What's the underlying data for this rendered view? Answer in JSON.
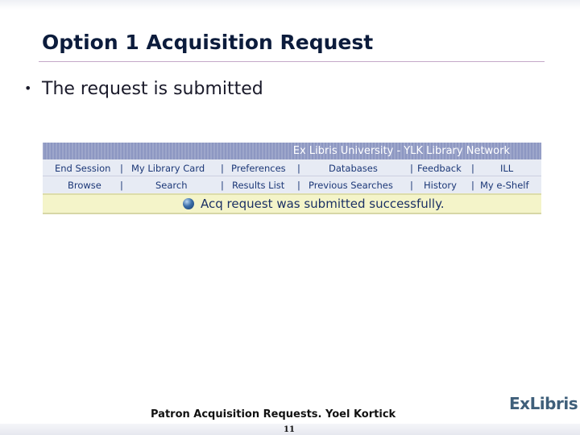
{
  "slide": {
    "title": "Option 1 Acquisition Request",
    "bullet": "The request is submitted",
    "bullet_marker": "•"
  },
  "screenshot": {
    "header_title": "Ex Libris University - YLK Library Network",
    "nav_row1": [
      "End Session",
      "My Library Card",
      "Preferences",
      "Databases",
      "Feedback",
      "ILL"
    ],
    "nav_row2": [
      "Browse",
      "Search",
      "Results List",
      "Previous Searches",
      "History",
      "My e-Shelf"
    ],
    "separator": "|",
    "message": "Acq request was submitted successfully."
  },
  "footer": {
    "caption": "Patron Acquisition Requests.  Yoel Kortick",
    "page_number": "11",
    "logo": "ExLibris"
  },
  "colors": {
    "header_bar": "#8d97c2",
    "nav_bg": "#e7ebf4",
    "nav_link": "#1b3777",
    "message_bg": "#f4f4c9",
    "title_text": "#0c1c3c",
    "logo": "#3f5f7a"
  },
  "icons": {
    "message_icon": "blue-orb-icon"
  }
}
